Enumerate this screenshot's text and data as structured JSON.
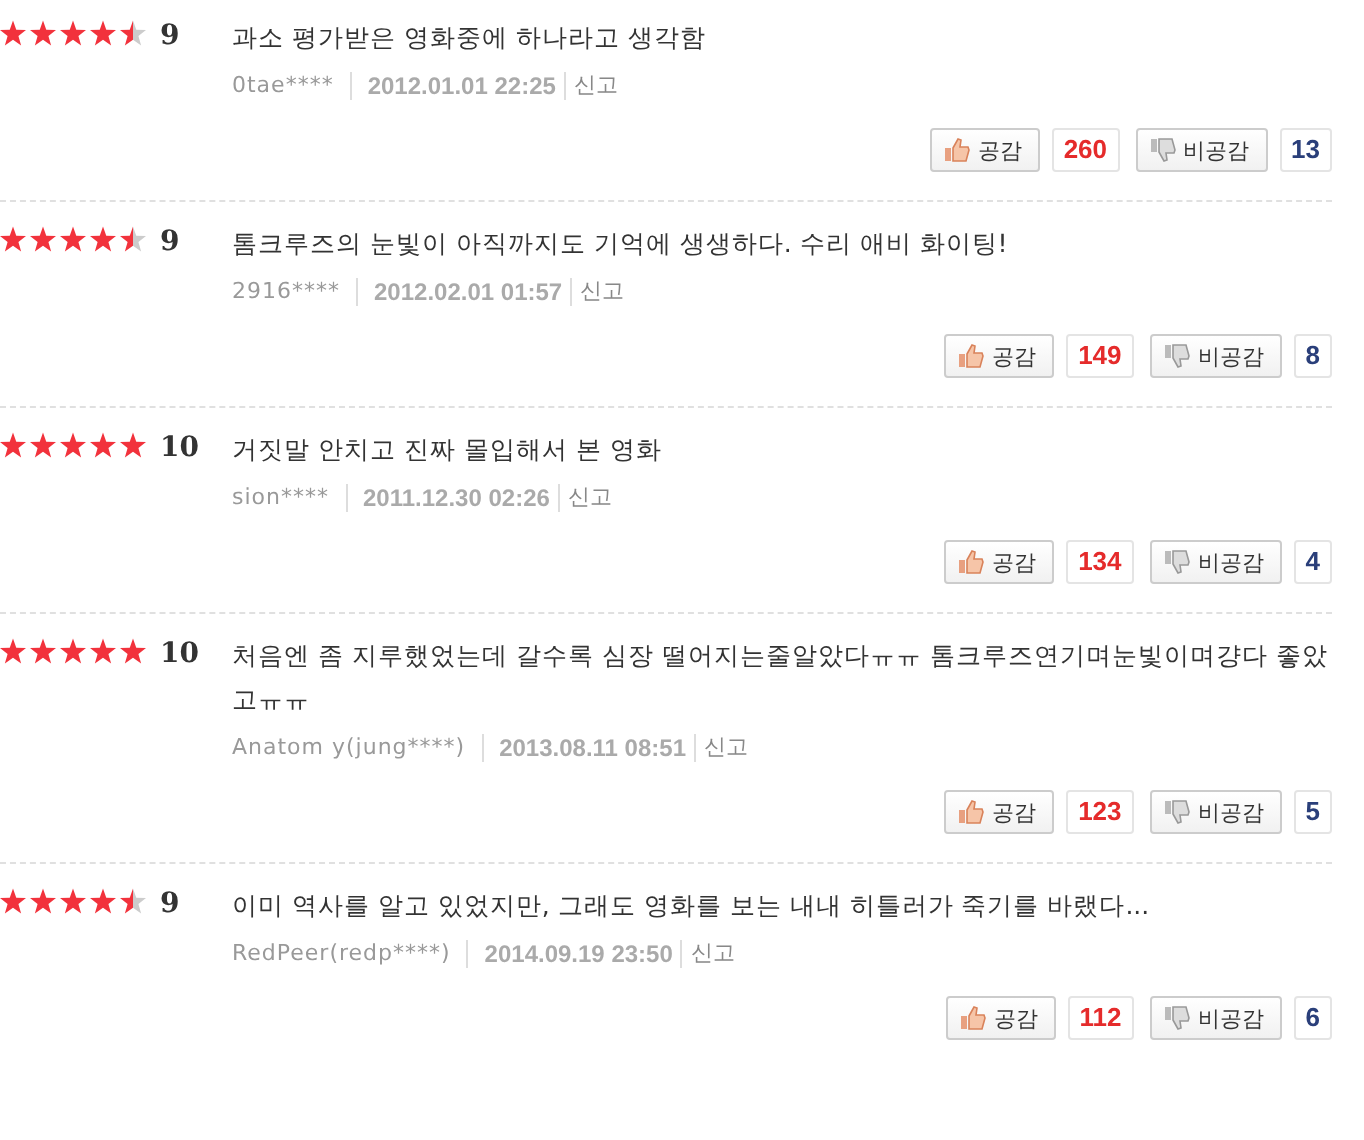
{
  "reviews": [
    {
      "stars": 4.5,
      "score": "9",
      "text": "과소 평가받은 영화중에 하나라고 생각함",
      "user": "0tae****",
      "date": "2012.01.01 22:25",
      "report": "신고",
      "like_label": "공감",
      "like_count": "260",
      "dislike_label": "비공감",
      "dislike_count": "13"
    },
    {
      "stars": 4.5,
      "score": "9",
      "text": "톰크루즈의 눈빛이 아직까지도 기억에 생생하다. 수리 애비 화이팅!",
      "user": "2916****",
      "date": "2012.02.01 01:57",
      "report": "신고",
      "like_label": "공감",
      "like_count": "149",
      "dislike_label": "비공감",
      "dislike_count": "8"
    },
    {
      "stars": 5,
      "score": "10",
      "text": "거짓말 안치고 진짜 몰입해서 본 영화",
      "user": "sion****",
      "date": "2011.12.30 02:26",
      "report": "신고",
      "like_label": "공감",
      "like_count": "134",
      "dislike_label": "비공감",
      "dislike_count": "4"
    },
    {
      "stars": 5,
      "score": "10",
      "text": "처음엔 좀 지루했었는데 갈수록 심장 떨어지는줄알았다ㅠㅠ 톰크루즈연기며눈빛이며걍다 좋았고ㅠㅠ",
      "user": "Anatom y(jung****)",
      "date": "2013.08.11 08:51",
      "report": "신고",
      "like_label": "공감",
      "like_count": "123",
      "dislike_label": "비공감",
      "dislike_count": "5"
    },
    {
      "stars": 4.5,
      "score": "9",
      "text": "이미 역사를 알고 있었지만, 그래도 영화를 보는 내내 히틀러가 죽기를 바랬다...",
      "user": "RedPeer(redp****)",
      "date": "2014.09.19 23:50",
      "report": "신고",
      "like_label": "공감",
      "like_count": "112",
      "dislike_label": "비공감",
      "dislike_count": "6"
    }
  ]
}
